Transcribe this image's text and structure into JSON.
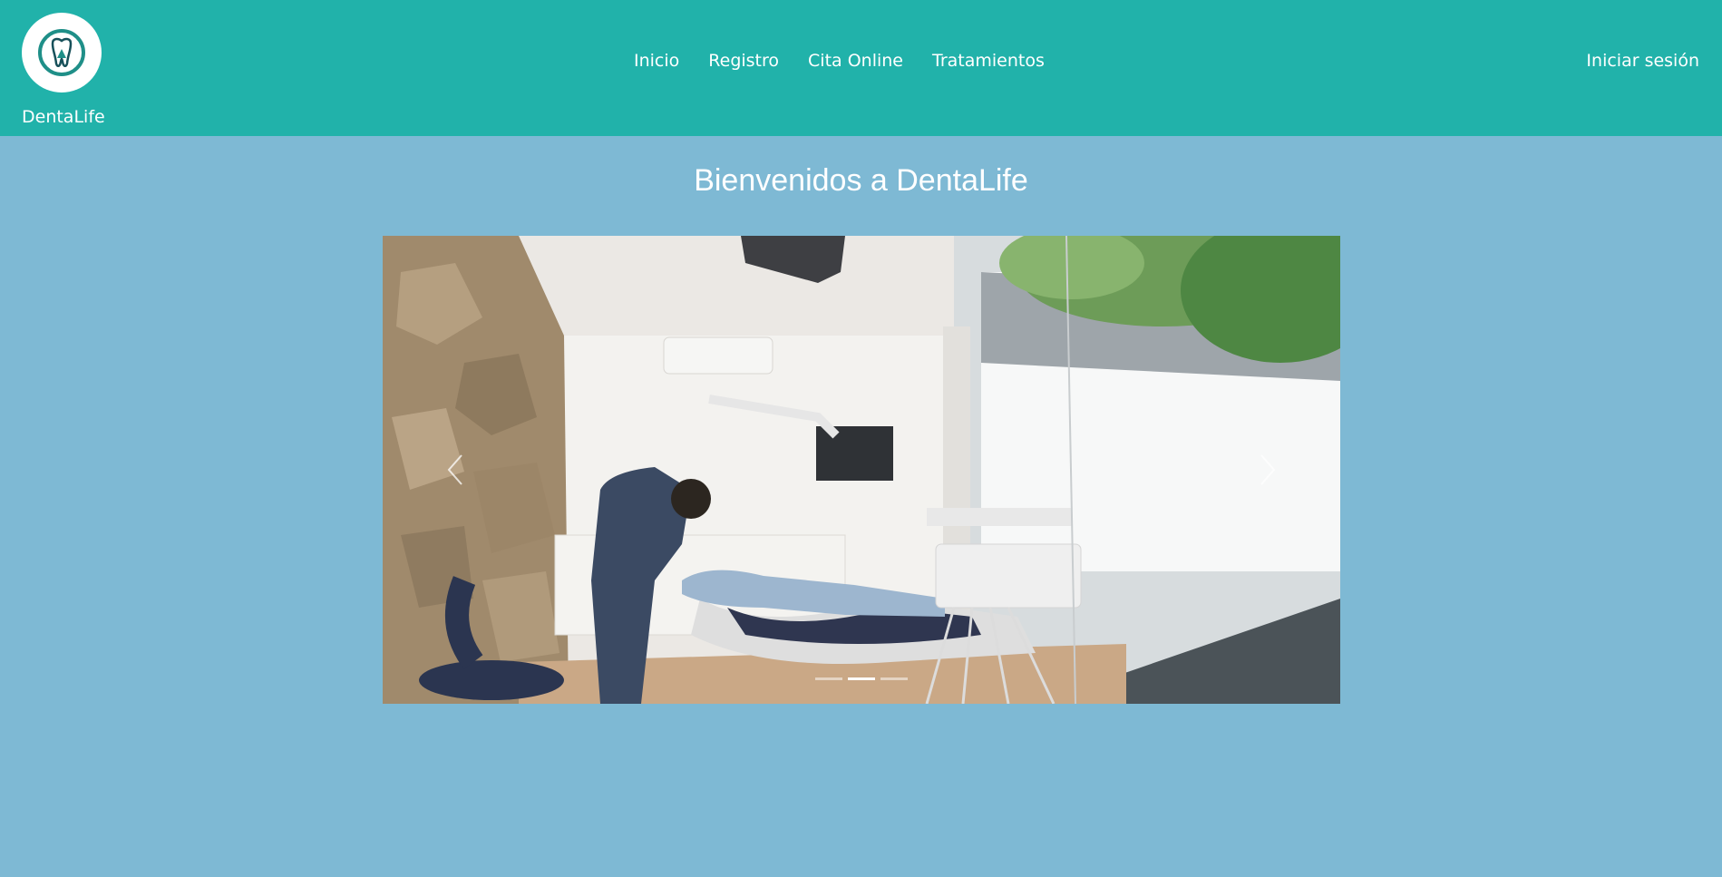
{
  "brand": {
    "name": "DentaLife",
    "logo_icon": "tooth-icon"
  },
  "nav": {
    "items": [
      {
        "label": "Inicio"
      },
      {
        "label": "Registro"
      },
      {
        "label": "Cita Online"
      },
      {
        "label": "Tratamientos"
      }
    ],
    "login_label": "Iniciar sesión"
  },
  "main": {
    "title": "Bienvenidos a DentaLife"
  },
  "carousel": {
    "slide_count": 3,
    "active_index": 1,
    "prev_icon": "chevron-left-icon",
    "next_icon": "chevron-right-icon"
  },
  "colors": {
    "header": "#21b2aa",
    "background": "#7eb9d4",
    "text": "#ffffff"
  }
}
